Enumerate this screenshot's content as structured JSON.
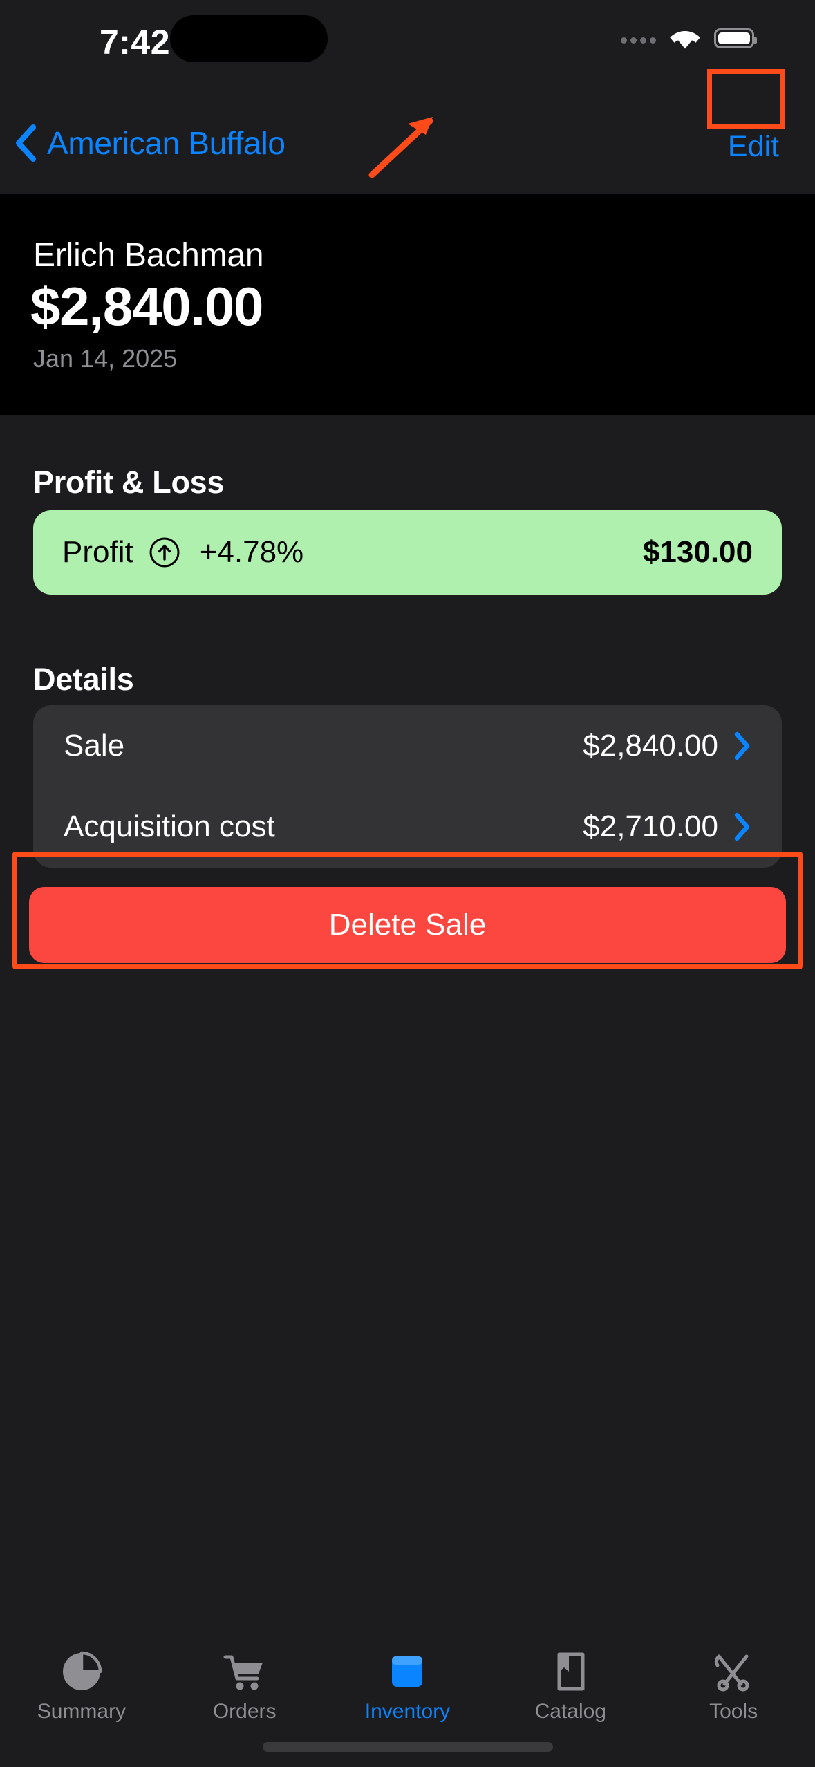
{
  "status_bar": {
    "time": "7:42",
    "cellular_icon": "cellular-dots-icon",
    "wifi_icon": "wifi-icon",
    "battery_icon": "battery-icon"
  },
  "nav_bar": {
    "back_icon": "chevron-left-icon",
    "back_label": "American Buffalo",
    "edit_label": "Edit"
  },
  "hero": {
    "customer_name": "Erlich Bachman",
    "amount": "$2,840.00",
    "date": "Jan 14, 2025"
  },
  "profit_loss": {
    "section_title": "Profit & Loss",
    "label": "Profit",
    "trend_icon": "arrow-up-circle-icon",
    "percent": "+4.78%",
    "value": "$130.00",
    "pill_color": "#B0F0AE",
    "text_color": "#000000"
  },
  "details": {
    "section_title": "Details",
    "rows": [
      {
        "label": "Sale",
        "value": "$2,840.00",
        "chevron_icon": "chevron-right-icon"
      },
      {
        "label": "Acquisition cost",
        "value": "$2,710.00",
        "chevron_icon": "chevron-right-icon"
      }
    ]
  },
  "actions": {
    "delete_label": "Delete Sale",
    "delete_color": "#FC4740"
  },
  "annotations": {
    "highlight_color": "#FF4A1A",
    "edit_box": "highlight-box-edit",
    "delete_box": "highlight-box-delete",
    "arrow": "pointer-arrow"
  },
  "tab_bar": {
    "items": [
      {
        "label": "Summary",
        "icon": "pie-chart-icon",
        "active": false
      },
      {
        "label": "Orders",
        "icon": "shopping-cart-icon",
        "active": false
      },
      {
        "label": "Inventory",
        "icon": "box-icon",
        "active": true
      },
      {
        "label": "Catalog",
        "icon": "book-icon",
        "active": false
      },
      {
        "label": "Tools",
        "icon": "tools-icon",
        "active": false
      }
    ],
    "active_color": "#0A84FF",
    "inactive_color": "#8E8E93"
  }
}
